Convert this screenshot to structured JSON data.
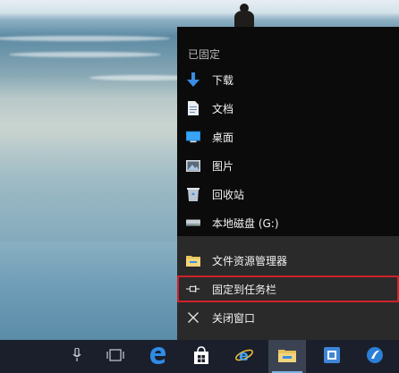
{
  "jumplist": {
    "section_title": "已固定",
    "pinned": [
      {
        "label": "下载",
        "icon": "download-arrow-icon"
      },
      {
        "label": "文档",
        "icon": "document-icon"
      },
      {
        "label": "桌面",
        "icon": "desktop-icon"
      },
      {
        "label": "图片",
        "icon": "pictures-icon"
      },
      {
        "label": "回收站",
        "icon": "recycle-bin-icon"
      },
      {
        "label": "本地磁盘 (G:)",
        "icon": "drive-icon"
      }
    ],
    "actions": [
      {
        "label": "文件资源管理器",
        "icon": "file-explorer-icon"
      },
      {
        "label": "固定到任务栏",
        "icon": "pin-icon"
      },
      {
        "label": "关闭窗口",
        "icon": "close-icon"
      }
    ]
  },
  "taskbar": {
    "icons": [
      "microphone-icon",
      "task-view-icon",
      "edge-icon",
      "store-icon",
      "internet-explorer-icon",
      "file-explorer-icon",
      "app-icon",
      "app-blue-icon"
    ]
  },
  "colors": {
    "highlight_border": "#d0222a",
    "download_arrow": "#3a8ee6",
    "taskbar_bg": "#1a1f2b"
  }
}
